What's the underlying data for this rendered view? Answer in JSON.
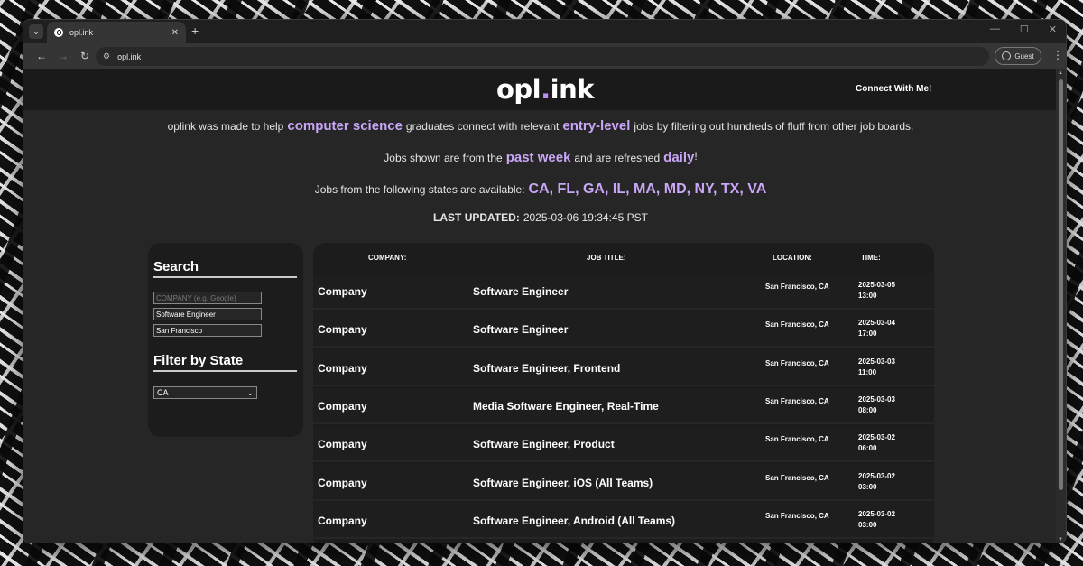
{
  "browser": {
    "tab_title": "opl.ink",
    "url": "opl.ink",
    "profile_label": "Guest",
    "new_tab_symbol": "+",
    "tab_close_symbol": "✕",
    "win_minimize": "—",
    "win_maximize": "☐",
    "win_close": "✕"
  },
  "header": {
    "logo_part1": "opl",
    "logo_dot": ".",
    "logo_part2": "ink",
    "connect_label": "Connect With Me!"
  },
  "intro": {
    "line1": {
      "t1": "oplink was made to help",
      "h1": "computer science",
      "t2": "graduates connect with relevant",
      "h2": "entry-level",
      "t3": "jobs by filtering out hundreds of fluff from other job boards."
    },
    "line2": {
      "t1": "Jobs shown are from the",
      "h1": "past week",
      "t2": "and are refreshed",
      "h2": "daily",
      "t3": "!"
    },
    "line3": {
      "t1": "Jobs from the following states are available:",
      "h1": "CA, FL, GA, IL, MA, MD, NY, TX, VA"
    },
    "updated_label": "LAST UPDATED:",
    "updated_value": "2025-03-06 19:34:45 PST"
  },
  "sidebar": {
    "search_heading": "Search",
    "company_placeholder": "COMPANY (e.g. Google)",
    "company_value": "",
    "title_value": "Software Engineer",
    "location_value": "San Francisco",
    "filter_heading": "Filter by State",
    "state_selected": "CA"
  },
  "table": {
    "headers": {
      "company": "COMPANY:",
      "title": "JOB TITLE:",
      "location": "LOCATION:",
      "time": "TIME:"
    },
    "rows": [
      {
        "company": "Company",
        "title": "Software Engineer",
        "location": "San Francisco, CA",
        "date": "2025-03-05",
        "time": "13:00"
      },
      {
        "company": "Company",
        "title": "Software Engineer",
        "location": "San Francisco, CA",
        "date": "2025-03-04",
        "time": "17:00"
      },
      {
        "company": "Company",
        "title": "Software Engineer, Frontend",
        "location": "San Francisco, CA",
        "date": "2025-03-03",
        "time": "11:00"
      },
      {
        "company": "Company",
        "title": "Media Software Engineer, Real-Time",
        "location": "San Francisco, CA",
        "date": "2025-03-03",
        "time": "08:00"
      },
      {
        "company": "Company",
        "title": "Software Engineer, Product",
        "location": "San Francisco, CA",
        "date": "2025-03-02",
        "time": "06:00"
      },
      {
        "company": "Company",
        "title": "Software Engineer, iOS (All Teams)",
        "location": "San Francisco, CA",
        "date": "2025-03-02",
        "time": "03:00"
      },
      {
        "company": "Company",
        "title": "Software Engineer, Android (All Teams)",
        "location": "San Francisco, CA",
        "date": "2025-03-02",
        "time": "03:00"
      }
    ]
  },
  "colors": {
    "accent": "#c9a6f7",
    "page_bg": "#262626",
    "header_bg": "#1a1a1a",
    "panel_bg": "#1c1c1c"
  }
}
